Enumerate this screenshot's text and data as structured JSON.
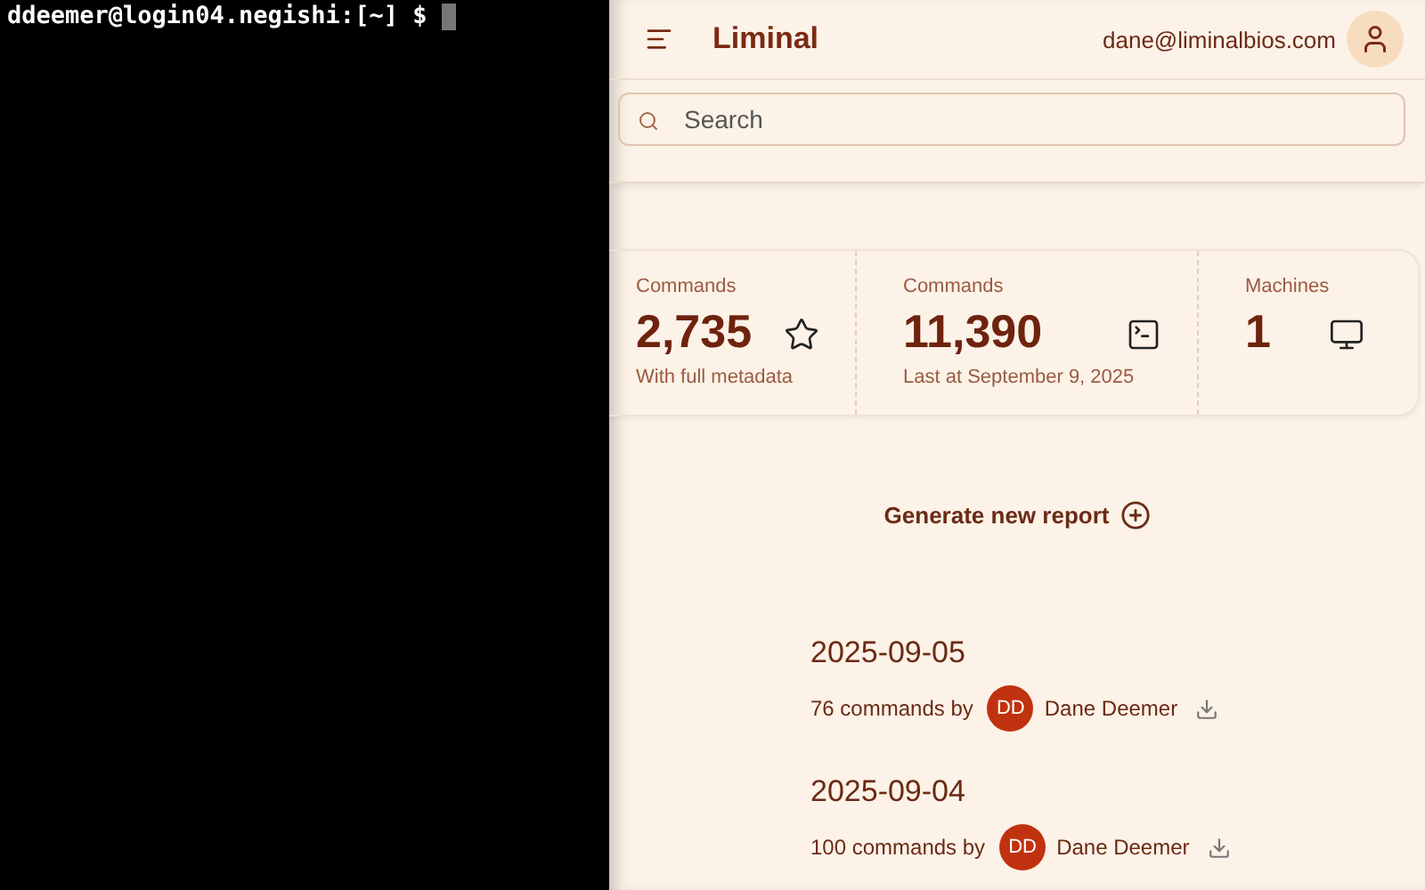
{
  "terminal": {
    "prompt": "ddeemer@login04.negishi:[~] $"
  },
  "header": {
    "title": "Liminal",
    "user_email": "dane@liminalbios.com"
  },
  "search": {
    "placeholder": "Search"
  },
  "stats": [
    {
      "label": "Commands",
      "value": "2,735",
      "caption": "With full metadata"
    },
    {
      "label": "Commands",
      "value": "11,390",
      "caption": "Last at September 9, 2025"
    },
    {
      "label": "Machines",
      "value": "1"
    }
  ],
  "generate_button": {
    "label": "Generate new report"
  },
  "reports": [
    {
      "date": "2025-09-05",
      "summary": "76 commands by",
      "initials": "DD",
      "author": "Dane Deemer"
    },
    {
      "date": "2025-09-04",
      "summary": "100 commands by",
      "initials": "DD",
      "author": "Dane Deemer"
    }
  ]
}
